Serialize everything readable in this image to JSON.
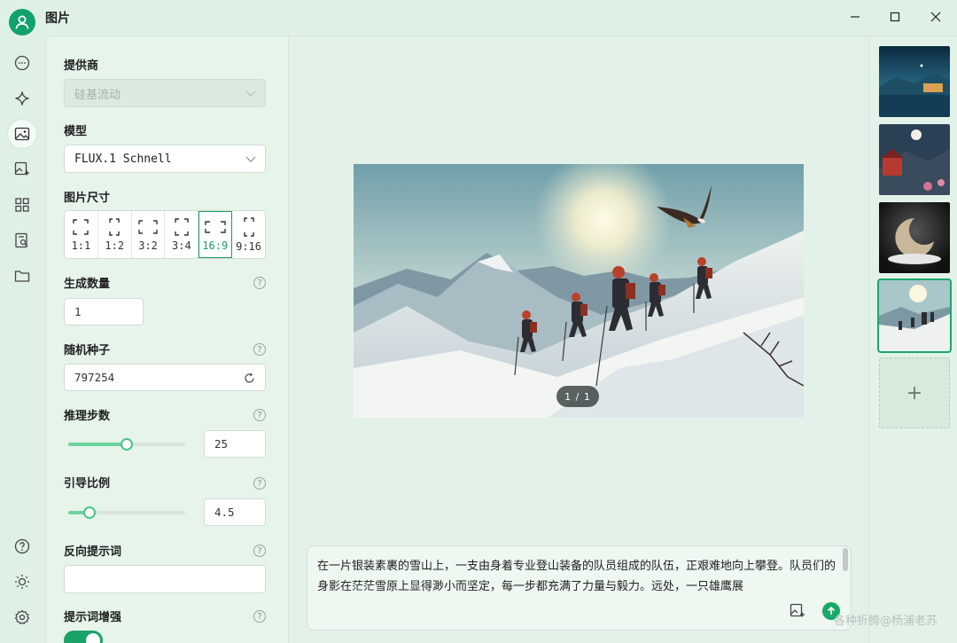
{
  "window": {
    "title": "图片"
  },
  "rail": {
    "items": [
      {
        "icon": "chat-bubble-icon"
      },
      {
        "icon": "sparkle-icon"
      },
      {
        "icon": "image-icon",
        "active": true
      },
      {
        "icon": "image-edit-icon"
      },
      {
        "icon": "apps-grid-icon"
      },
      {
        "icon": "document-search-icon"
      },
      {
        "icon": "folder-icon"
      }
    ],
    "bottom": [
      {
        "icon": "help-icon"
      },
      {
        "icon": "sun-icon"
      },
      {
        "icon": "settings-gear-icon"
      }
    ]
  },
  "settings": {
    "provider_label": "提供商",
    "provider_value": "硅基流动",
    "model_label": "模型",
    "model_value": "FLUX.1 Schnell",
    "size_label": "图片尺寸",
    "sizes": [
      "1:1",
      "1:2",
      "3:2",
      "3:4",
      "16:9",
      "9:16"
    ],
    "selected_size": "16:9",
    "count_label": "生成数量",
    "count_value": "1",
    "seed_label": "随机种子",
    "seed_value": "797254",
    "steps_label": "推理步数",
    "steps_value": "25",
    "steps_fraction": 0.5,
    "guidance_label": "引导比例",
    "guidance_value": "4.5",
    "guidance_fraction": 0.18,
    "negative_label": "反向提示词",
    "negative_value": "",
    "enhance_label": "提示词增强",
    "enhance_on": true,
    "help_glyph": "?"
  },
  "main": {
    "counter": "1 / 1",
    "prompt": "在一片银装素裹的雪山上，一支由身着专业登山装备的队员组成的队伍，正艰难地向上攀登。队员们的身影在茫茫雪原上显得渺小而坚定，每一步都充满了力量与毅力。远处，一只雄鹰展"
  },
  "history": {
    "add_glyph": "+"
  },
  "watermark": "各种折腾@杨浦老苏",
  "colors": {
    "accent": "#1aa867",
    "background": "#dff0e5"
  }
}
